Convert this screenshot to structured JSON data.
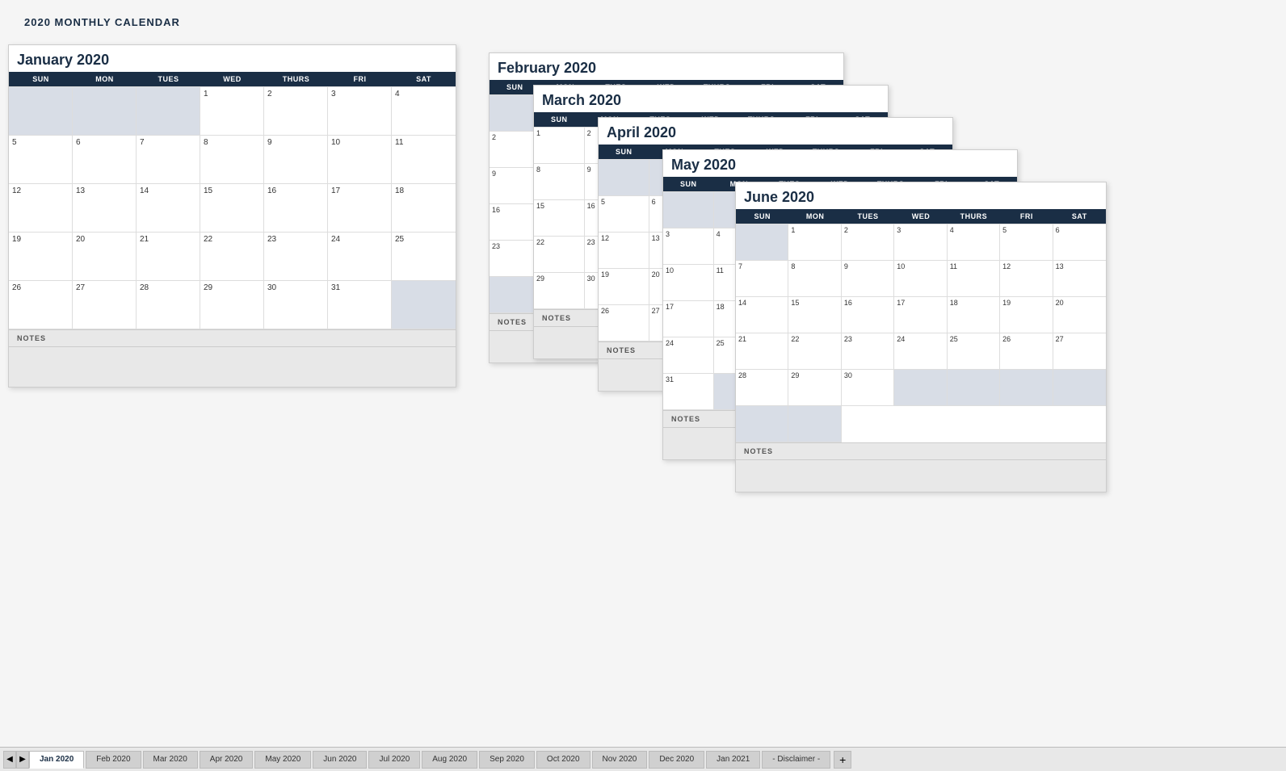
{
  "app": {
    "title": "2020 MONTHLY CALENDAR"
  },
  "tabs": [
    {
      "label": "Jan 2020",
      "active": true
    },
    {
      "label": "Feb 2020",
      "active": false
    },
    {
      "label": "Mar 2020",
      "active": false
    },
    {
      "label": "Apr 2020",
      "active": false
    },
    {
      "label": "May 2020",
      "active": false
    },
    {
      "label": "Jun 2020",
      "active": false
    },
    {
      "label": "Jul 2020",
      "active": false
    },
    {
      "label": "Aug 2020",
      "active": false
    },
    {
      "label": "Sep 2020",
      "active": false
    },
    {
      "label": "Oct 2020",
      "active": false
    },
    {
      "label": "Nov 2020",
      "active": false
    },
    {
      "label": "Dec 2020",
      "active": false
    },
    {
      "label": "Jan 2021",
      "active": false
    },
    {
      "label": "- Disclaimer -",
      "active": false
    }
  ],
  "calendars": {
    "january": {
      "title": "January 2020",
      "headers": [
        "SUN",
        "MON",
        "TUES",
        "WED",
        "THURS",
        "FRI",
        "SAT"
      ]
    },
    "february": {
      "title": "February 2020",
      "headers": [
        "SUN",
        "MON",
        "TUES",
        "WED",
        "THURS",
        "FRI",
        "SAT"
      ]
    },
    "march": {
      "title": "March 2020",
      "headers": [
        "SUN",
        "MON",
        "TUES",
        "WED",
        "THURS",
        "FRI",
        "SAT"
      ]
    },
    "april": {
      "title": "April 2020",
      "headers": [
        "SUN",
        "MON",
        "TUES",
        "WED",
        "THURS",
        "FRI",
        "SAT"
      ]
    },
    "may": {
      "title": "May 2020",
      "headers": [
        "SUN",
        "MON",
        "TUES",
        "WED",
        "THURS",
        "FRI",
        "SAT"
      ]
    },
    "june": {
      "title": "June 2020",
      "headers": [
        "SUN",
        "MON",
        "TUES",
        "WED",
        "THURS",
        "FRI",
        "SAT"
      ]
    }
  },
  "notes_label": "NOTES"
}
